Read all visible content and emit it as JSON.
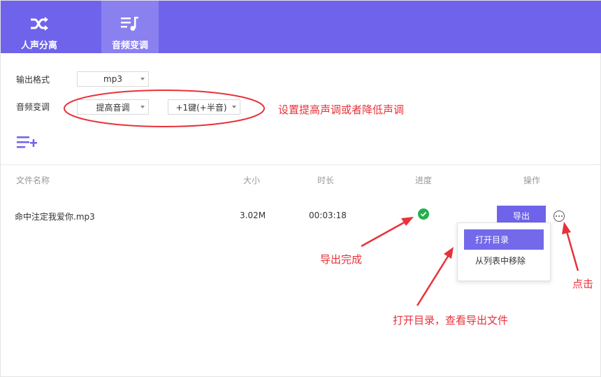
{
  "tabs": [
    {
      "label": "人声分离",
      "icon": "shuffle-icon"
    },
    {
      "label": "音频变调",
      "icon": "music-list-icon",
      "active": true
    }
  ],
  "settings": {
    "format_label": "输出格式",
    "format_value": "mp3",
    "pitch_label": "音频变调",
    "pitch_mode_value": "提高音调",
    "pitch_amount_value": "+1键(+半音)"
  },
  "table": {
    "headers": [
      "文件名称",
      "大小",
      "时长",
      "进度",
      "操作"
    ],
    "rows": [
      {
        "name": "命中注定我爱你.mp3",
        "size": "3.02M",
        "duration": "00:03:18",
        "progress": "done",
        "action": "导出"
      }
    ]
  },
  "context_menu": {
    "items": [
      "打开目录",
      "从列表中移除"
    ]
  },
  "annotations": {
    "pitch_note": "设置提高声调或者降低声调",
    "export_done": "导出完成",
    "open_dir": "打开目录，查看导出文件",
    "click": "点击"
  },
  "colors": {
    "brand": "#6e63ea",
    "annotation_red": "#e8323a",
    "success_green": "#22b14c"
  }
}
